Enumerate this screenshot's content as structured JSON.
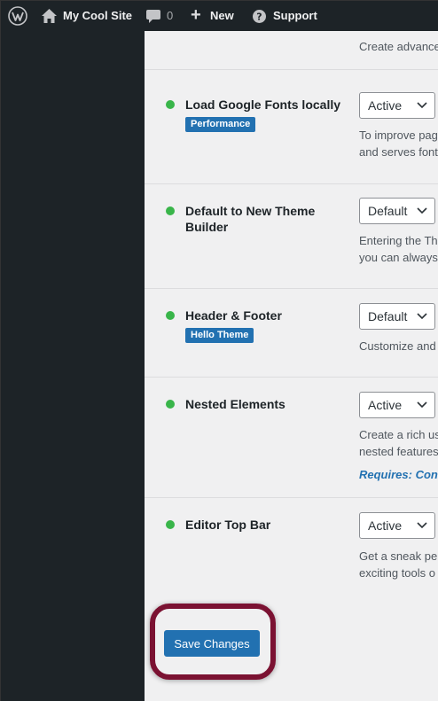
{
  "adminbar": {
    "site_name": "My Cool Site",
    "comment_count": "0",
    "new_plus": "+",
    "new_label": "New",
    "support_label": "Support"
  },
  "top_fragment": "Create advance",
  "features": [
    {
      "title": "Load Google Fonts locally",
      "tag": "Performance",
      "value": "Active",
      "desc": [
        "To improve pag",
        "and serves font"
      ]
    },
    {
      "title": "Default to New Theme Builder",
      "tag": "",
      "value": "Default",
      "desc": [
        "Entering the Th",
        "you can always"
      ]
    },
    {
      "title": "Header & Footer",
      "tag": "Hello Theme",
      "value": "Default",
      "desc": [
        "Customize and"
      ]
    },
    {
      "title": "Nested Elements",
      "tag": "",
      "value": "Active",
      "desc": [
        "Create a rich us",
        "nested features"
      ],
      "requires": "Requires: Con"
    },
    {
      "title": "Editor Top Bar",
      "tag": "",
      "value": "Active",
      "desc": [
        "Get a sneak pe",
        "exciting tools o"
      ]
    }
  ],
  "save_label": "Save Changes",
  "colors": {
    "adminbar_bg": "#1d2327",
    "active_dot": "#39b54a",
    "accent": "#2271b1",
    "highlight": "#7b1232"
  }
}
